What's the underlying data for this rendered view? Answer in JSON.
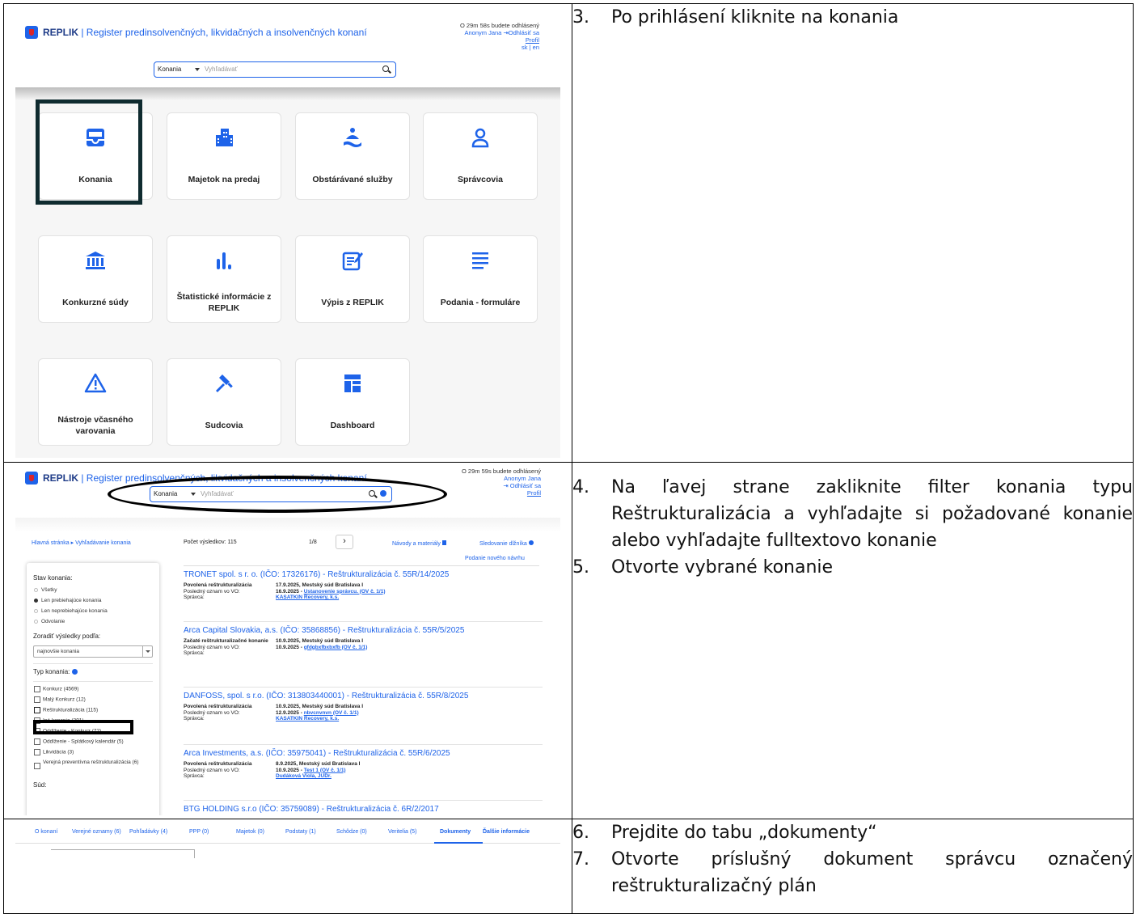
{
  "steps": {
    "s1": {
      "num": "3.",
      "text": "Po prihlásení kliknite na konania"
    },
    "s2": [
      {
        "num": "4.",
        "text": "Na ľavej strane zakliknite filter konania typu Reštrukturalizácia a vyhľadajte si požadované konanie alebo vyhľadajte fulltextovo konanie"
      },
      {
        "num": "5.",
        "text": "Otvorte vybrané konanie"
      }
    ],
    "s3": [
      {
        "num": "6.",
        "text": "Prejdite do tabu „dokumenty“"
      },
      {
        "num": "7.",
        "text": "Otvorte príslušný dokument správcu označený reštrukturalizačný plán"
      }
    ]
  },
  "screen1": {
    "brand": "REPLIK",
    "brand_sub": "| Register predinsolvenčných, likvidačných a insolvenčných konaní",
    "session": "O 29m 58s budete odhlásený",
    "user": "Anonym Jana",
    "logout": "Odhlásiť sa",
    "profile": "Profil",
    "lang": "sk | en",
    "search_select": "Konania",
    "search_placeholder": "Vyhľadávať",
    "tiles": [
      {
        "label": "Konania",
        "icon": "inbox-icon"
      },
      {
        "label": "Majetok na predaj",
        "icon": "building-icon"
      },
      {
        "label": "Obstárávané služby",
        "icon": "service-bell-icon"
      },
      {
        "label": "Správcovia",
        "icon": "person-icon"
      },
      {
        "label": "Konkurzné súdy",
        "icon": "courthouse-icon"
      },
      {
        "label": "Štatistické informácie z REPLIK",
        "icon": "bar-chart-icon"
      },
      {
        "label": "Výpis z REPLIK",
        "icon": "edit-note-icon"
      },
      {
        "label": "Podania - formuláre",
        "icon": "lines-icon"
      },
      {
        "label": "Nástroje včasného varovania",
        "icon": "warning-icon"
      },
      {
        "label": "Sudcovia",
        "icon": "gavel-icon"
      },
      {
        "label": "Dashboard",
        "icon": "dashboard-icon"
      }
    ]
  },
  "screen2": {
    "brand": "REPLIK",
    "brand_sub": "| Register predinsolvenčných, likvidačných a insolvenčných konaní",
    "session": "O 29m 59s budete odhlásený",
    "user": "Anonym Jana",
    "logout": "Odhlásiť sa",
    "profile": "Profil",
    "search_select": "Konania",
    "search_placeholder": "Vyhľadávať",
    "breadcrumb": "Hlavná stránka ▸ Vyhľadávanie konania",
    "count": "Počet výsledkov: 115",
    "pager": "1/8",
    "next": "›",
    "guides": "Návody a materiály",
    "track": "Sledovanie dlžníka",
    "new_filing": "Podanie nového návrhu",
    "filter": {
      "status_heading": "Stav konania:",
      "status_options": [
        "Všetky",
        "Len prebiehajúce konania",
        "Len neprebiehajúce konania",
        "Odvolanie"
      ],
      "sort_heading": "Zoradiť výsledky podľa:",
      "sort_value": "najnovšie konania",
      "type_heading": "Typ konania:",
      "types": [
        "Konkurz (4569)",
        "Malý Konkurz (12)",
        "Reštrukturalizácia (115)",
        "Iné konania (391)",
        "Oddlženie - Konkurz (72)",
        "Oddlženie - Splátkový kalendár (5)",
        "Likvidácia (3)",
        "Verejná preventívna reštrukturalizácia (6)"
      ],
      "court_heading": "Súd:"
    },
    "results": [
      {
        "title": "TRONET spol. s r. o. (IČO: 17326176) - Reštrukturalizácia č. 55R/14/2025",
        "rows": [
          {
            "k": "Povolená reštrukturalizácia",
            "v": "17.9.2025, Mestský súd Bratislava I",
            "link": ""
          },
          {
            "k": "Posledný oznam vo VO:",
            "v": "16.9.2025 - ",
            "link": "Ustanovenie správcu. (OV č. 1/1)"
          },
          {
            "k": "Správca:",
            "v": "",
            "link": "KASATKIN Recovery, k.s."
          }
        ]
      },
      {
        "title": "Arca Capital Slovakia, a.s. (IČO: 35868856) - Reštrukturalizácia č. 55R/5/2025",
        "rows": [
          {
            "k": "Začaté reštrukturalizačné konanie",
            "v": "10.9.2025, Mestský súd Bratislava I",
            "link": ""
          },
          {
            "k": "Posledný oznam vo VO:",
            "v": "10.9.2025 - ",
            "link": "gfdgbxfbxbxfb (OV č. 1/1)"
          },
          {
            "k": "Správca:",
            "v": "",
            "link": ""
          }
        ]
      },
      {
        "title": "DANFOSS, spol. s r.o. (IČO: 313803440001) - Reštrukturalizácia č. 55R/8/2025",
        "rows": [
          {
            "k": "Povolená reštrukturalizácia",
            "v": "10.9.2025, Mestský súd Bratislava I",
            "link": ""
          },
          {
            "k": "Posledný oznam vo VO:",
            "v": "12.9.2025 - ",
            "link": "nbvcnvnvn (OV č. 1/1)"
          },
          {
            "k": "Správca:",
            "v": "",
            "link": "KASATKIN Recovery, k.s."
          }
        ]
      },
      {
        "title": "Arca Investments, a.s. (IČO: 35975041) - Reštrukturalizácia č. 55R/6/2025",
        "rows": [
          {
            "k": "Povolená reštrukturalizácia",
            "v": "8.9.2025, Mestský súd Bratislava I",
            "link": ""
          },
          {
            "k": "Posledný oznam vo VO:",
            "v": "10.9.2025 - ",
            "link": "Test 1 (OV č. 1/1)"
          },
          {
            "k": "Správca:",
            "v": "",
            "link": "Dudáková Viola, JUDr."
          }
        ]
      },
      {
        "title": "BTG HOLDING s.r.o (IČO: 35759089) - Reštrukturalizácia č. 6R/2/2017",
        "rows": []
      }
    ]
  },
  "screen3": {
    "tabs": [
      "O konaní",
      "Verejné oznamy (6)",
      "Pohľadávky (4)",
      "PPP (0)",
      "Majetok (0)",
      "Podstaty (1)",
      "Schôdze (0)",
      "Veritelia (5)",
      "Dokumenty",
      "Ďalšie informácie"
    ]
  },
  "colors": {
    "accent": "#1e63e9",
    "highlight": "#0f2b2f"
  }
}
